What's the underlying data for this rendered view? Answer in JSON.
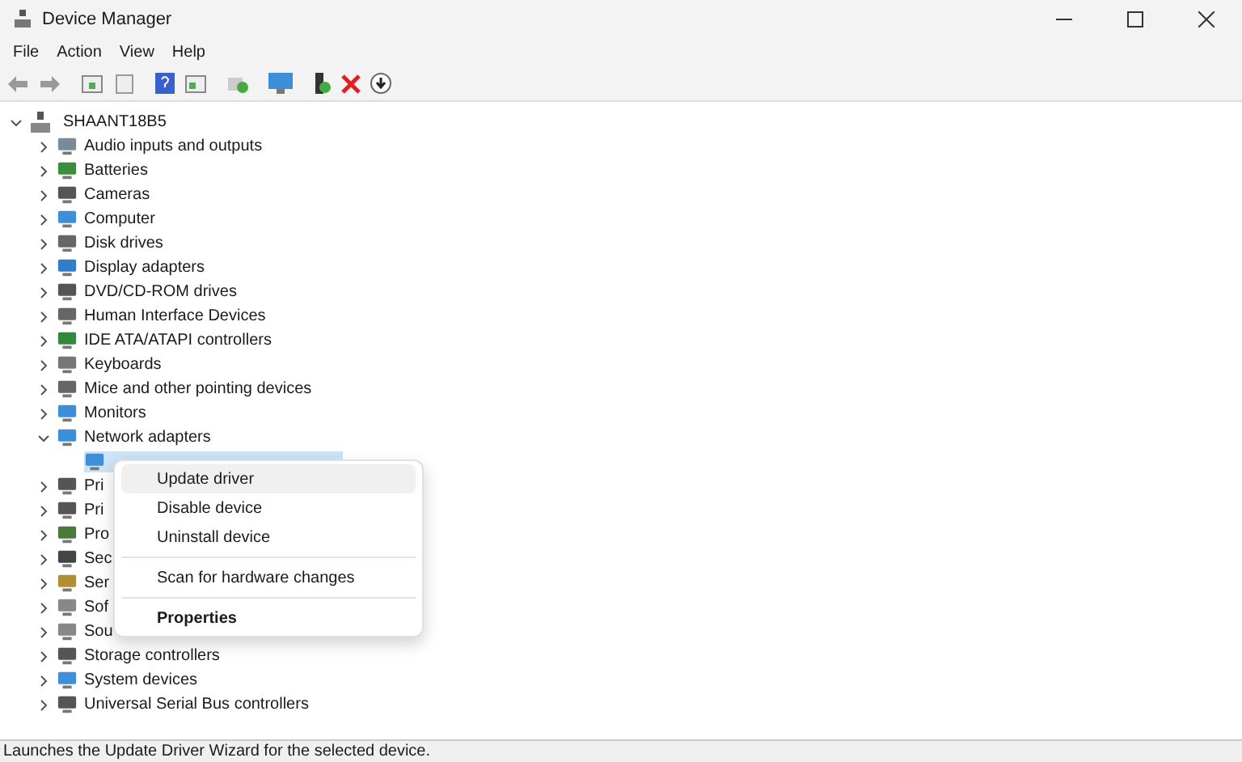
{
  "window": {
    "title": "Device Manager"
  },
  "menu_bar": [
    "File",
    "Action",
    "View",
    "Help"
  ],
  "tree": {
    "label": "SHAANT18B5",
    "expanded": true,
    "children": [
      {
        "label": "Audio inputs and outputs",
        "expanded": false
      },
      {
        "label": "Batteries",
        "expanded": false
      },
      {
        "label": "Cameras",
        "expanded": false
      },
      {
        "label": "Computer",
        "expanded": false
      },
      {
        "label": "Disk drives",
        "expanded": false
      },
      {
        "label": "Display adapters",
        "expanded": false
      },
      {
        "label": "DVD/CD-ROM drives",
        "expanded": false
      },
      {
        "label": "Human Interface Devices",
        "expanded": false
      },
      {
        "label": "IDE ATA/ATAPI controllers",
        "expanded": false
      },
      {
        "label": "Keyboards",
        "expanded": false
      },
      {
        "label": "Mice and other pointing devices",
        "expanded": false
      },
      {
        "label": "Monitors",
        "expanded": false
      },
      {
        "label": "Network adapters",
        "expanded": true,
        "children": [
          {
            "selected": true
          }
        ]
      },
      {
        "label": "Pri",
        "expanded": false
      },
      {
        "label": "Pri",
        "expanded": false
      },
      {
        "label": "Pro",
        "expanded": false
      },
      {
        "label": "Sec",
        "expanded": false
      },
      {
        "label": "Ser",
        "expanded": false
      },
      {
        "label": "Sof",
        "expanded": false
      },
      {
        "label": "Sou",
        "expanded": false
      },
      {
        "label": "Storage controllers",
        "expanded": false
      },
      {
        "label": "System devices",
        "expanded": false
      },
      {
        "label": "Universal Serial Bus controllers",
        "expanded": false
      }
    ]
  },
  "context_menu": [
    {
      "kind": "item",
      "label": "Update driver",
      "selected": true
    },
    {
      "kind": "item",
      "label": "Disable device",
      "selected": false
    },
    {
      "kind": "item",
      "label": "Uninstall device",
      "selected": false
    },
    {
      "kind": "separator"
    },
    {
      "kind": "item",
      "label": "Scan for hardware changes",
      "selected": false
    },
    {
      "kind": "separator"
    },
    {
      "kind": "default",
      "label": "Properties",
      "selected": false
    }
  ],
  "status_bar": "Launches the Update Driver Wizard for the selected device."
}
